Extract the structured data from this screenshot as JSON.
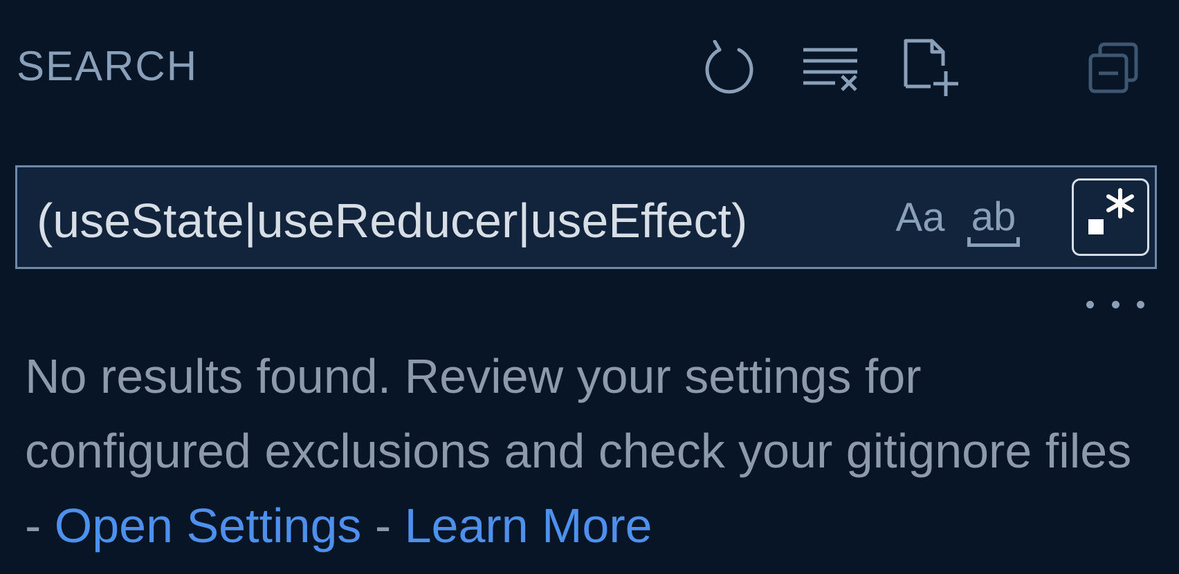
{
  "header": {
    "title": "SEARCH",
    "actions": [
      {
        "name": "refresh-icon",
        "label": "Refresh"
      },
      {
        "name": "clear-results-icon",
        "label": "Clear Search Results"
      },
      {
        "name": "new-search-editor-icon",
        "label": "Open New Search Editor"
      },
      {
        "name": "collapse-all-icon",
        "label": "Collapse All"
      }
    ]
  },
  "search": {
    "value": "(useState|useReducer|useEffect)",
    "options": {
      "match_case_label": "Aa",
      "whole_word_label": "ab",
      "regex_label": ".*",
      "regex_active": true
    }
  },
  "results": {
    "message_text": "No results found. Review your settings for configured exclusions and check your gitignore files - ",
    "open_settings_link": "Open Settings",
    "separator": " - ",
    "learn_more_link": "Learn More"
  },
  "colors": {
    "background": "#071526",
    "input_background": "#12243b",
    "input_border": "#6f8aa8",
    "muted_text": "#8c9aab",
    "link": "#4d90ee"
  }
}
